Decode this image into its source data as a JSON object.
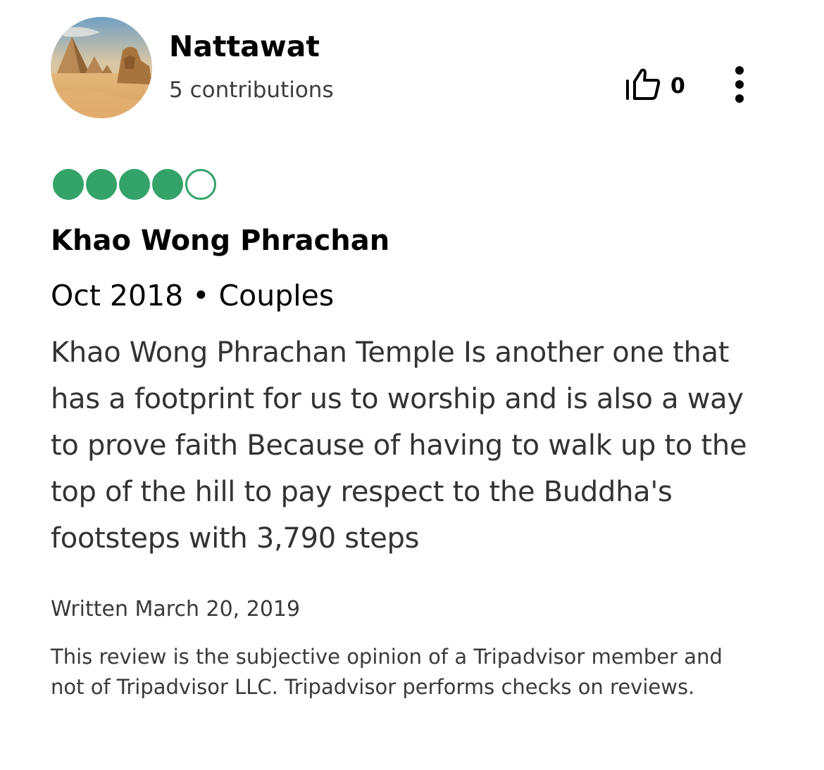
{
  "reviewer": {
    "name": "Nattawat",
    "contributions": "5 contributions",
    "avatar_icon": "pyramids-sphinx-photo"
  },
  "actions": {
    "helpful_icon": "thumbs-up-icon",
    "helpful_count": "0",
    "more_icon": "more-vertical-icon"
  },
  "review": {
    "rating": 4,
    "rating_max": 5,
    "bubble_color": "#34a36a",
    "title": "Khao Wong Phrachan",
    "meta": "Oct 2018 • Couples",
    "body": "Khao Wong Phrachan Temple Is another one that has a footprint for us to worship and is also a way to prove faith Because of having to walk up to the top of the hill to pay respect to the Buddha's footsteps with 3,790 steps",
    "written": "Written March 20, 2019"
  },
  "disclaimer": "This review is the subjective opinion of a Tripadvisor member and not of Tripadvisor LLC. Tripadvisor performs checks on reviews."
}
